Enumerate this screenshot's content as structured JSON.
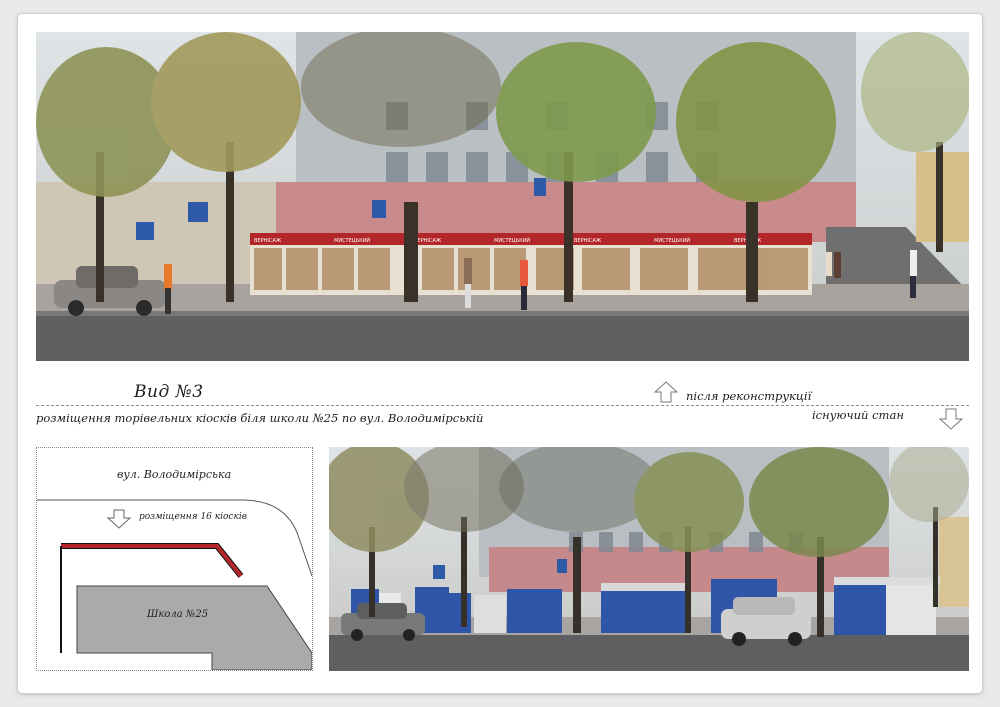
{
  "view": {
    "title": "Вид №3",
    "subtitle": "розміщення торівельних кіосків біля школи №25 по вул. Володимірській",
    "after_label": "після реконструкції",
    "existing_label": "існуючий стан"
  },
  "plan": {
    "street_label": "вул. Володимірська",
    "placement_label": "розміщення 16 кіосків",
    "school_label": "Школа №25"
  },
  "photos": {
    "top_kiosk_signs": [
      "ВЕРНІСАЖ",
      "МИСТЕЦЬКИЙ",
      "ВЕРНІСАЖ",
      "МИСТЕЦЬКИЙ",
      "ВЕРНІСАЖ",
      "МИСТЕЦЬКИЙ",
      "ВЕРНІСАЖ"
    ]
  },
  "colors": {
    "kiosk_red": "#b3262a",
    "kiosk_blue": "#2f55a8",
    "building_pink": "#c9898b",
    "school_gray": "#aaaaaa",
    "road": "#5e5f61"
  }
}
